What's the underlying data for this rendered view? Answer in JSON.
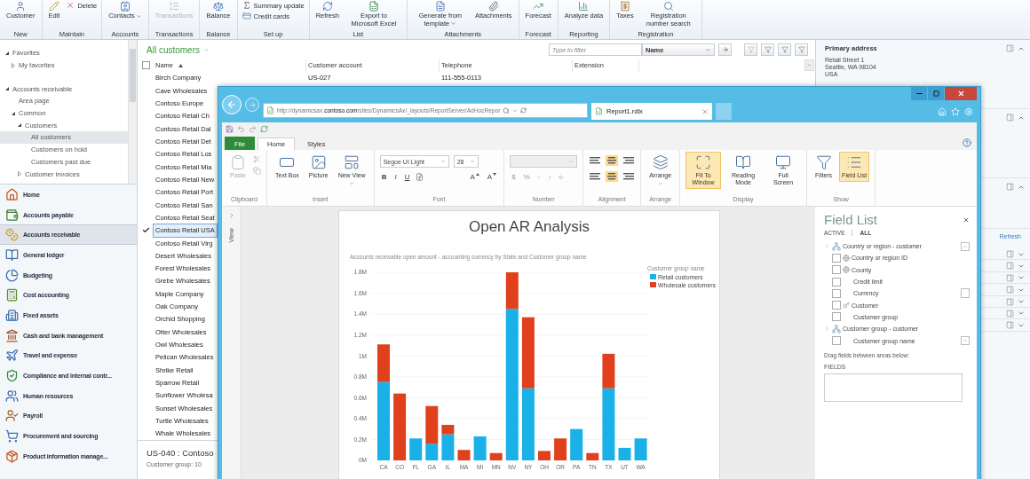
{
  "ribbon": {
    "groups": [
      {
        "label": "New",
        "buttons": [
          {
            "label": "Customer",
            "kind": "large",
            "disabled": false,
            "dropdown": false
          }
        ]
      },
      {
        "label": "Maintain",
        "buttons": [
          {
            "label": "Edit",
            "kind": "large",
            "disabled": false,
            "dropdown": false
          },
          {
            "label": "Delete",
            "kind": "small",
            "disabled": false,
            "dropdown": false
          }
        ]
      },
      {
        "label": "Accounts",
        "buttons": [
          {
            "label": "Contacts",
            "kind": "large",
            "disabled": false,
            "dropdown": true
          }
        ]
      },
      {
        "label": "Transactions",
        "buttons": [
          {
            "label": "Transactions",
            "kind": "large",
            "disabled": true,
            "dropdown": false
          }
        ]
      },
      {
        "label": "Balance",
        "buttons": [
          {
            "label": "Balance",
            "kind": "large",
            "disabled": false,
            "dropdown": false
          }
        ]
      },
      {
        "label": "Set up",
        "buttons": [
          {
            "label": "Summary update",
            "kind": "small",
            "disabled": false,
            "dropdown": false
          },
          {
            "label": "Credit cards",
            "kind": "small",
            "disabled": false,
            "dropdown": false
          }
        ]
      },
      {
        "label": "List",
        "buttons": [
          {
            "label": "Refresh",
            "kind": "large",
            "disabled": false,
            "dropdown": false
          },
          {
            "label": "Export to Microsoft Excel",
            "kind": "large",
            "disabled": false,
            "dropdown": false
          }
        ]
      },
      {
        "label": "Attachments",
        "buttons": [
          {
            "label": "Generate from template",
            "kind": "large",
            "disabled": false,
            "dropdown": true
          },
          {
            "label": "Attachments",
            "kind": "large",
            "disabled": false,
            "dropdown": false
          }
        ]
      },
      {
        "label": "Forecast",
        "buttons": [
          {
            "label": "Forecast",
            "kind": "large",
            "disabled": false,
            "dropdown": false
          }
        ]
      },
      {
        "label": "Reporting",
        "buttons": [
          {
            "label": "Analyze data",
            "kind": "large",
            "disabled": false,
            "dropdown": false
          }
        ]
      },
      {
        "label": "Registration",
        "buttons": [
          {
            "label": "Taxes",
            "kind": "large",
            "disabled": false,
            "dropdown": false
          },
          {
            "label": "Registration number search",
            "kind": "large",
            "disabled": false,
            "dropdown": false
          }
        ]
      }
    ]
  },
  "nav": {
    "tree": [
      {
        "label": "Favorites",
        "expanded": true,
        "selected": false,
        "children": [
          {
            "label": "My favorites",
            "expanded": false,
            "selected": false
          }
        ]
      },
      {
        "label": "Accounts receivable",
        "expanded": true,
        "selected": false,
        "children": [
          {
            "label": "Area page",
            "selected": false
          },
          {
            "label": "Common",
            "expanded": true,
            "selected": false,
            "children": [
              {
                "label": "Customers",
                "expanded": true,
                "selected": false,
                "children": [
                  {
                    "label": "All customers",
                    "selected": true
                  },
                  {
                    "label": "Customers on hold",
                    "selected": false
                  },
                  {
                    "label": "Customers past due",
                    "selected": false
                  }
                ]
              },
              {
                "label": "Customer invoices",
                "expanded": false,
                "selected": false
              }
            ]
          }
        ]
      }
    ],
    "modules": [
      {
        "label": "Home",
        "selected": false
      },
      {
        "label": "Accounts payable",
        "selected": false
      },
      {
        "label": "Accounts receivable",
        "selected": true
      },
      {
        "label": "General ledger",
        "selected": false
      },
      {
        "label": "Budgeting",
        "selected": false
      },
      {
        "label": "Cost accounting",
        "selected": false
      },
      {
        "label": "Fixed assets",
        "selected": false
      },
      {
        "label": "Cash and bank management",
        "selected": false
      },
      {
        "label": "Travel and expense",
        "selected": false
      },
      {
        "label": "Compliance and internal contr...",
        "selected": false
      },
      {
        "label": "Human resources",
        "selected": false
      },
      {
        "label": "Payroll",
        "selected": false
      },
      {
        "label": "Procurement and sourcing",
        "selected": false
      },
      {
        "label": "Product information manage...",
        "selected": false
      }
    ]
  },
  "list": {
    "title": "All customers",
    "select_all": false,
    "filter": {
      "placeholder": "Type to filter",
      "field": "Name"
    },
    "columns": [
      "Name",
      "Customer account",
      "Telephone",
      "Extension"
    ],
    "rows": [
      {
        "cells": [
          "Birch Company",
          "US-027",
          "111-555-0113"
        ],
        "checked": false,
        "selected": false
      },
      {
        "cells": [
          "Cave Wholesales"
        ],
        "checked": false,
        "selected": false
      },
      {
        "cells": [
          "Contoso Europe"
        ],
        "checked": false,
        "selected": false
      },
      {
        "cells": [
          "Contoso Retail Ch"
        ],
        "checked": false,
        "selected": false
      },
      {
        "cells": [
          "Contoso Retail Dal"
        ],
        "checked": false,
        "selected": false
      },
      {
        "cells": [
          "Contoso Retail Det"
        ],
        "checked": false,
        "selected": false
      },
      {
        "cells": [
          "Contoso Retail Los"
        ],
        "checked": false,
        "selected": false
      },
      {
        "cells": [
          "Contoso Retail Mia"
        ],
        "checked": false,
        "selected": false
      },
      {
        "cells": [
          "Contoso Retail New"
        ],
        "checked": false,
        "selected": false
      },
      {
        "cells": [
          "Contoso Retail Port"
        ],
        "checked": false,
        "selected": false
      },
      {
        "cells": [
          "Contoso Retail San"
        ],
        "checked": false,
        "selected": false
      },
      {
        "cells": [
          "Contoso Retail Seat"
        ],
        "checked": false,
        "selected": false
      },
      {
        "cells": [
          "Contoso Retail USA"
        ],
        "checked": true,
        "selected": true
      },
      {
        "cells": [
          "Contoso Retail Virg"
        ],
        "checked": false,
        "selected": false
      },
      {
        "cells": [
          "Desert Wholesales"
        ],
        "checked": false,
        "selected": false
      },
      {
        "cells": [
          "Forest Wholesales"
        ],
        "checked": false,
        "selected": false
      },
      {
        "cells": [
          "Grebe Wholesales"
        ],
        "checked": false,
        "selected": false
      },
      {
        "cells": [
          "Maple Company"
        ],
        "checked": false,
        "selected": false
      },
      {
        "cells": [
          "Oak Company"
        ],
        "checked": false,
        "selected": false
      },
      {
        "cells": [
          "Orchid Shopping"
        ],
        "checked": false,
        "selected": false
      },
      {
        "cells": [
          "Otter Wholesales"
        ],
        "checked": false,
        "selected": false
      },
      {
        "cells": [
          "Owl Wholesales"
        ],
        "checked": false,
        "selected": false
      },
      {
        "cells": [
          "Pelican Wholesales"
        ],
        "checked": false,
        "selected": false
      },
      {
        "cells": [
          "Shrike Retail"
        ],
        "checked": false,
        "selected": false
      },
      {
        "cells": [
          "Sparrow Retail"
        ],
        "checked": false,
        "selected": false
      },
      {
        "cells": [
          "Sunflower Wholesa"
        ],
        "checked": false,
        "selected": false
      },
      {
        "cells": [
          "Sunset Wholesales"
        ],
        "checked": false,
        "selected": false
      },
      {
        "cells": [
          "Turtle Wholesales"
        ],
        "checked": false,
        "selected": false
      },
      {
        "cells": [
          "Whale Wholesales"
        ],
        "checked": false,
        "selected": false
      }
    ],
    "detail": {
      "title": "US-040 : Contoso",
      "line": "Customer group: 10"
    }
  },
  "factboxes": {
    "upper": [
      {
        "title": "Primary address",
        "lines": [
          "Retail Street 1",
          "Seattle, WA 98104",
          "USA"
        ],
        "expanded": true
      },
      {
        "expanded": true
      },
      {
        "expanded": true
      }
    ],
    "refresh": "Refresh",
    "lower": [
      {
        "expanded": false
      },
      {
        "expanded": false
      },
      {
        "expanded": false
      },
      {
        "expanded": false
      },
      {
        "expanded": false
      },
      {
        "expanded": false
      },
      {
        "expanded": false
      }
    ]
  },
  "report_window": {
    "address": "http://dynamicsax.**contoso.com**/sites/DynamicsAx/_layouts/ReportServer/AdHocRepor",
    "tab": "Report1.rdlx",
    "ribbon_tabs": [
      {
        "label": "File",
        "kind": "file",
        "selected": false
      },
      {
        "label": "Home",
        "kind": "tab",
        "selected": true
      },
      {
        "label": "Styles",
        "kind": "tab",
        "selected": false
      }
    ],
    "ribbon_groups": [
      {
        "label": "Clipboard",
        "kind": "clipboard",
        "buttons": [
          {
            "label": "Paste",
            "disabled": true,
            "selected": false,
            "dropdown": false
          }
        ]
      },
      {
        "label": "Insert",
        "kind": "buttons",
        "buttons": [
          {
            "label": "Text Box",
            "disabled": false,
            "selected": false,
            "dropdown": false
          },
          {
            "label": "Picture",
            "disabled": false,
            "selected": false,
            "dropdown": false
          },
          {
            "label": "New View",
            "disabled": false,
            "selected": false,
            "dropdown": true
          }
        ]
      },
      {
        "label": "Font",
        "kind": "font",
        "font": "Segoe UI Light",
        "size": "28",
        "styles": [
          "B",
          "I",
          "U"
        ],
        "sizers": [
          "A",
          "A"
        ]
      },
      {
        "label": "Number",
        "kind": "number",
        "symbols": [
          "$",
          "%"
        ]
      },
      {
        "label": "Alignment",
        "kind": "alignment"
      },
      {
        "label": "Arrange",
        "kind": "buttons",
        "buttons": [
          {
            "label": "Arrange",
            "disabled": false,
            "selected": false,
            "dropdown": true
          }
        ]
      },
      {
        "label": "Display",
        "kind": "buttons",
        "buttons": [
          {
            "label": "Fit To Window",
            "disabled": false,
            "selected": true,
            "dropdown": false
          },
          {
            "label": "Reading Mode",
            "disabled": false,
            "selected": false,
            "dropdown": false
          },
          {
            "label": "Full Screen",
            "disabled": false,
            "selected": false,
            "dropdown": false
          }
        ]
      },
      {
        "label": "Show",
        "kind": "buttons",
        "buttons": [
          {
            "label": "Filters",
            "disabled": false,
            "selected": false,
            "dropdown": false
          },
          {
            "label": "Field List",
            "disabled": false,
            "selected": true,
            "dropdown": false
          }
        ]
      }
    ],
    "view_strip": "View",
    "paper": {
      "title": "Open AR Analysis",
      "chart_data": {
        "type": "bar",
        "stacked": true,
        "grid": true,
        "legend": "right",
        "legend_title": "Customer group name",
        "title": "Accounts receivable open amount - accounting currency by State and Customer group name",
        "categories": [
          "CA",
          "CO",
          "FL",
          "GA",
          "IL",
          "MA",
          "MI",
          "MN",
          "NV",
          "NY",
          "OH",
          "OR",
          "PA",
          "TN",
          "TX",
          "UT",
          "WA"
        ],
        "series": [
          {
            "name": "Retail customers",
            "color": "#1ab0e8",
            "values": [
              0.75,
              null,
              0.21,
              0.16,
              0.25,
              null,
              0.23,
              null,
              1.45,
              0.69,
              null,
              null,
              0.3,
              null,
              0.69,
              0.12,
              0.21
            ]
          },
          {
            "name": "Wholesale customers",
            "color": "#e0401c",
            "values": [
              0.36,
              0.64,
              null,
              0.36,
              0.09,
              0.1,
              null,
              0.07,
              0.35,
              0.68,
              0.09,
              0.21,
              null,
              0.07,
              0.33,
              null,
              null
            ]
          }
        ],
        "ylim": [
          0,
          1.8
        ],
        "yticks": [
          {
            "value": 0,
            "label": "0M"
          },
          {
            "value": 0.2,
            "label": "0.2M"
          },
          {
            "value": 0.4,
            "label": "0.4M"
          },
          {
            "value": 0.6,
            "label": "0.6M"
          },
          {
            "value": 0.8,
            "label": "0.8M"
          },
          {
            "value": 1,
            "label": "1M"
          },
          {
            "value": 1.2,
            "label": "1.2M"
          },
          {
            "value": 1.4,
            "label": "1.4M"
          },
          {
            "value": 1.6,
            "label": "1.6M"
          },
          {
            "value": 1.8,
            "label": "1.8M"
          }
        ]
      }
    },
    "field_list": {
      "title": "Field List",
      "tabs": [
        {
          "label": "ACTIVE",
          "selected": false
        },
        {
          "label": "ALL",
          "selected": true
        }
      ],
      "tables": [
        {
          "label": "Country or region - customer",
          "children": [
            {
              "label": "Country or region ID",
              "kind": "geo",
              "checked": false
            },
            {
              "label": "County",
              "kind": "geo",
              "checked": false
            },
            {
              "label": "Credit limit",
              "kind": "plain",
              "checked": false
            },
            {
              "label": "Currency",
              "kind": "plain",
              "checked": false
            },
            {
              "label": "Customer",
              "kind": "key",
              "checked": false
            },
            {
              "label": "Customer group",
              "kind": "plain",
              "checked": false
            }
          ]
        },
        {
          "label": "Customer group - customer",
          "children": [
            {
              "label": "Customer group name",
              "kind": "plain",
              "checked": false
            }
          ]
        }
      ],
      "hint": "Drag fields between areas below:",
      "area_label": "FIELDS"
    }
  }
}
